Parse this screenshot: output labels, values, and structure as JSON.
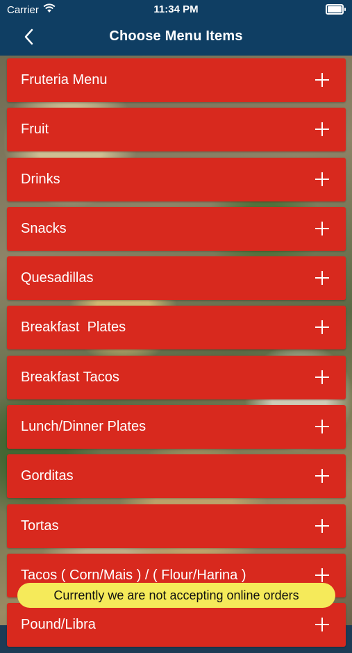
{
  "status_bar": {
    "carrier": "Carrier",
    "time": "11:34 PM",
    "icons": [
      "wifi-icon",
      "battery-icon"
    ]
  },
  "nav": {
    "title": "Choose Menu Items",
    "back_icon": "chevron-left-icon"
  },
  "menu_items": [
    {
      "label": "Fruteria Menu"
    },
    {
      "label": "Fruit"
    },
    {
      "label": "Drinks"
    },
    {
      "label": "Snacks"
    },
    {
      "label": "Quesadillas"
    },
    {
      "label": "Breakfast  Plates"
    },
    {
      "label": "Breakfast Tacos"
    },
    {
      "label": "Lunch/Dinner Plates"
    },
    {
      "label": "Gorditas"
    },
    {
      "label": "Tortas"
    },
    {
      "label": "Tacos ( Corn/Mais ) / ( Flour/Harina )"
    },
    {
      "label": "Pound/Libra"
    }
  ],
  "toast": {
    "message": "Currently we are not accepting online orders"
  },
  "colors": {
    "nav_background": "#0f3e63",
    "menu_item_background": "#d8291e",
    "toast_background": "#f5ea5a"
  }
}
